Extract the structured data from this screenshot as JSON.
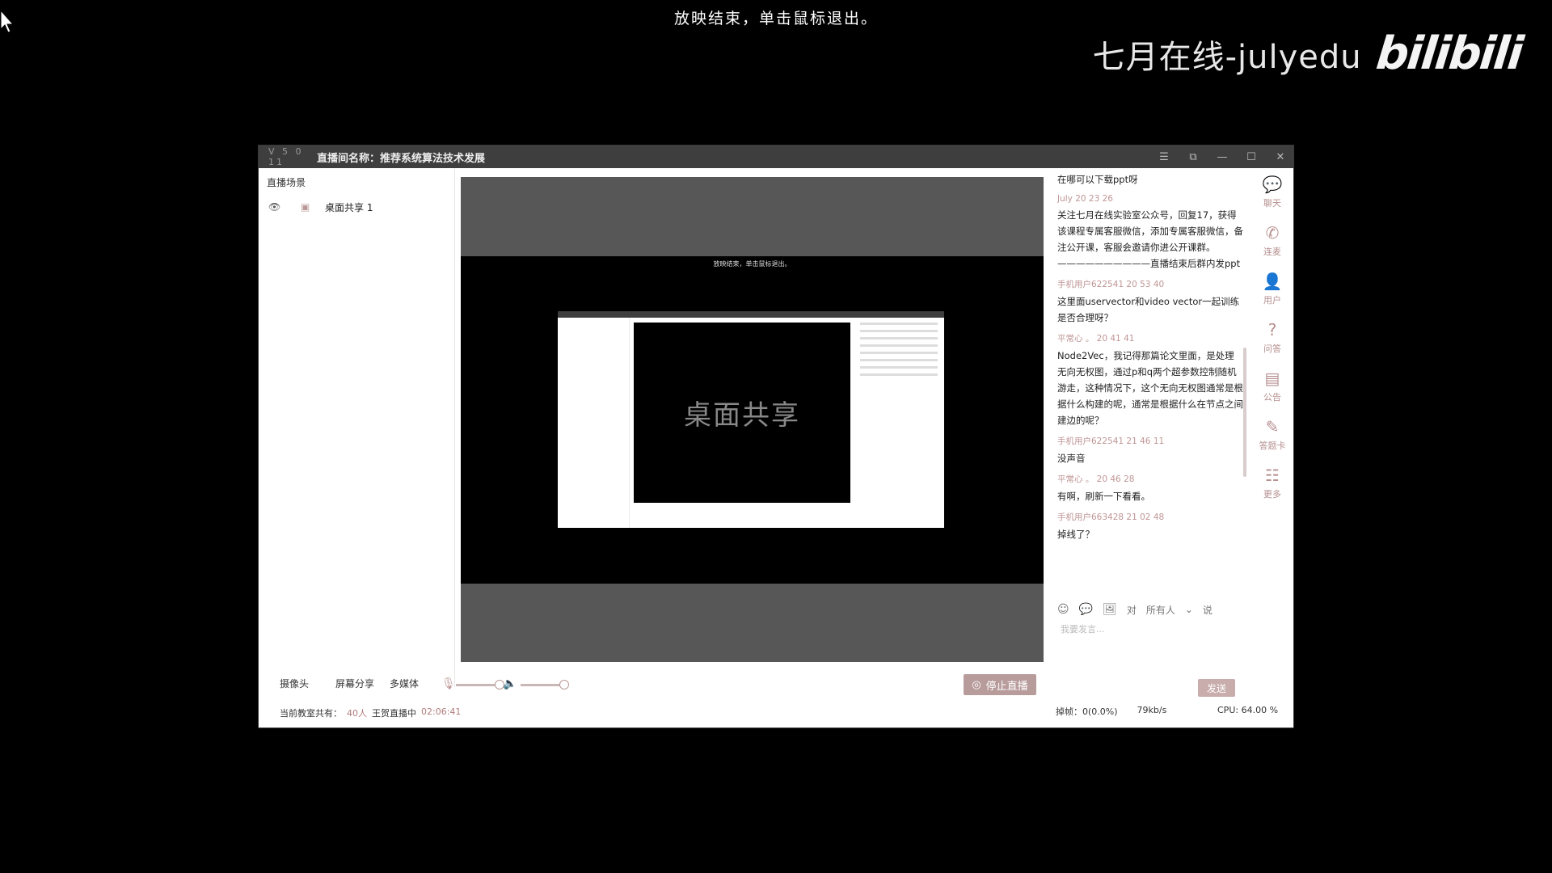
{
  "overlay": {
    "message": "放映结束，单击鼠标退出。",
    "watermark_text": "七月在线-julyedu",
    "watermark_logo": "bilibili"
  },
  "window": {
    "version": "V 5 0 11",
    "title": "直播间名称：推荐系统算法技术发展",
    "controls": [
      "menu",
      "restore",
      "minimize",
      "maximize",
      "close"
    ]
  },
  "left_panel": {
    "heading": "直播场景",
    "scenes": [
      {
        "label": "桌面共享 1"
      }
    ]
  },
  "stage": {
    "inner_message": "放映结束，单击鼠标退出。",
    "share_label": "桌面共享"
  },
  "bottom": {
    "tools": [
      "摄像头",
      "屏幕分享",
      "多媒体"
    ],
    "stop_button": "停止直播",
    "status_prefix": "当前教室共有：",
    "count": "40人",
    "teacher": "王贺直播中",
    "elapsed": "02:06:41"
  },
  "chat": {
    "messages": [
      {
        "who": "",
        "text": "在哪可以下载ppt呀"
      },
      {
        "who": "July 20 23 26",
        "text": "关注七月在线实验室公众号，回复17，获得该课程专属客服微信，添加专属客服微信，备注公开课，客服会邀请你进公开课群。——————————直播结束后群内发ppt"
      },
      {
        "who": "手机用户622541 20 53 40",
        "text": "这里面uservector和video  vector一起训练是否合理呀？"
      },
      {
        "who": "平常心 。 20 41 41",
        "text": "Node2Vec，我记得那篇论文里面，是处理无向无权图，通过p和q两个超参数控制随机游走，这种情况下，这个无向无权图通常是根据什么构建的呢，通常是根据什么在节点之间建边的呢？"
      },
      {
        "who": "手机用户622541 21 46 11",
        "text": "没声音"
      },
      {
        "who": "平常心 。 20 46 28",
        "text": "有啊，刷新一下看看。"
      },
      {
        "who": "手机用户663428 21 02 48",
        "text": "掉线了？"
      }
    ],
    "target_label": "对",
    "target_value": "所有人",
    "say_label": "说",
    "input_placeholder": "我要发言...",
    "send_button": "发送"
  },
  "side_icons": [
    {
      "icon": "chat-icon",
      "label": "聊天"
    },
    {
      "icon": "phone-icon",
      "label": "连麦"
    },
    {
      "icon": "user-icon",
      "label": "用户"
    },
    {
      "icon": "question-icon",
      "label": "问答"
    },
    {
      "icon": "notice-icon",
      "label": "公告"
    },
    {
      "icon": "answer-card-icon",
      "label": "答题卡"
    },
    {
      "icon": "more-icon",
      "label": "更多"
    }
  ],
  "network": {
    "dropped_label": "掉帧：",
    "dropped_value": "0(0.0%)",
    "rate": "79kb/s",
    "cpu_label": "CPU:",
    "cpu_value": "64.00 %"
  }
}
